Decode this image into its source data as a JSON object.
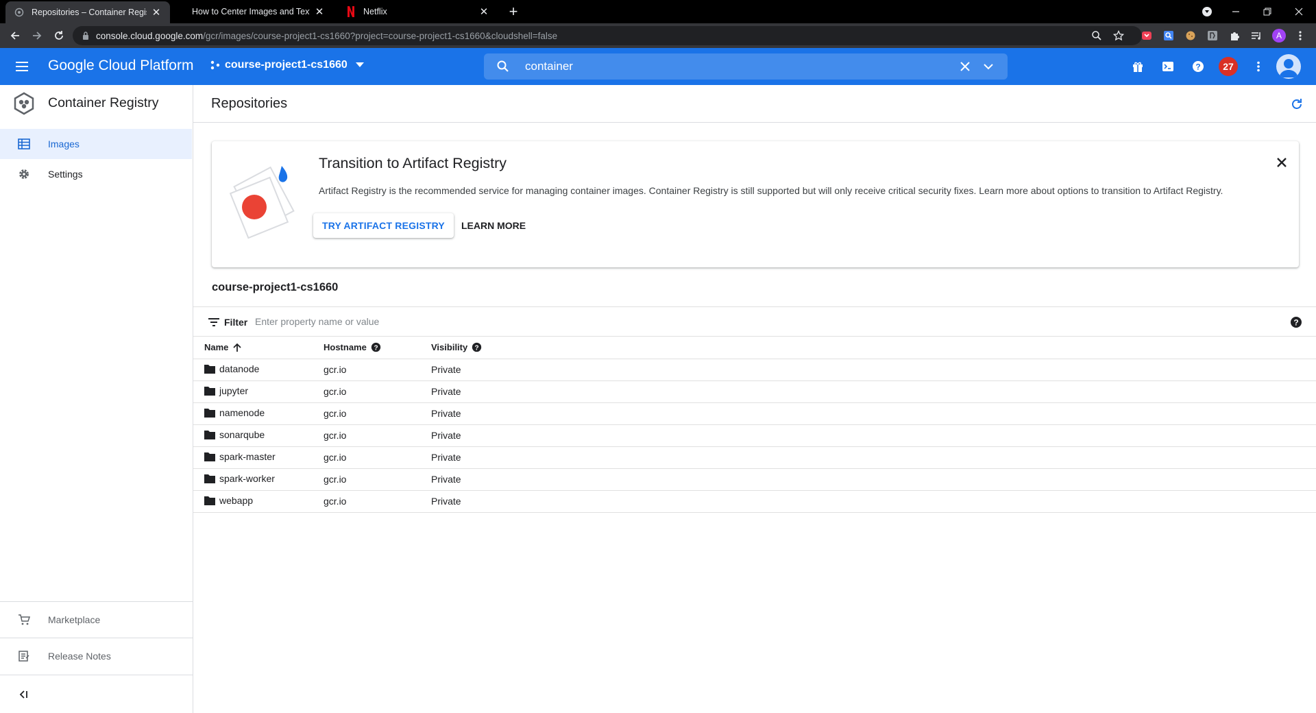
{
  "browser": {
    "tabs": [
      {
        "title": "Repositories – Container Registry",
        "active": true,
        "icon": "gcp-favicon"
      },
      {
        "title": "How to Center Images and Text i",
        "active": false,
        "icon": "none"
      },
      {
        "title": "Netflix",
        "active": false,
        "icon": "netflix-icon"
      }
    ],
    "url_host": "console.cloud.google.com",
    "url_path": "/gcr/images/course-project1-cs1660?project=course-project1-cs1660&cloudshell=false",
    "profile_initial": "A"
  },
  "header": {
    "brand": "Google Cloud Platform",
    "project": "course-project1-cs1660",
    "search_value": "container",
    "notifications_count": "27",
    "accent_color": "#1a73e8"
  },
  "sidebar": {
    "product_name": "Container Registry",
    "items": [
      {
        "label": "Images",
        "icon": "list-icon",
        "active": true
      },
      {
        "label": "Settings",
        "icon": "gear-icon",
        "active": false
      }
    ],
    "bottom": [
      {
        "label": "Marketplace",
        "icon": "cart-icon"
      },
      {
        "label": "Release Notes",
        "icon": "notes-icon"
      }
    ]
  },
  "main": {
    "page_title": "Repositories",
    "banner": {
      "title": "Transition to Artifact Registry",
      "description": "Artifact Registry is the recommended service for managing container images. Container Registry is still supported but will only receive critical security fixes. Learn more about options to transition to Artifact Registry.",
      "primary_button": "TRY ARTIFACT REGISTRY",
      "secondary_button": "LEARN MORE"
    },
    "section_title": "course-project1-cs1660",
    "filter": {
      "label": "Filter",
      "placeholder": "Enter property name or value"
    },
    "table": {
      "columns": [
        "Name",
        "Hostname",
        "Visibility"
      ],
      "rows": [
        {
          "name": "datanode",
          "hostname": "gcr.io",
          "visibility": "Private"
        },
        {
          "name": "jupyter",
          "hostname": "gcr.io",
          "visibility": "Private"
        },
        {
          "name": "namenode",
          "hostname": "gcr.io",
          "visibility": "Private"
        },
        {
          "name": "sonarqube",
          "hostname": "gcr.io",
          "visibility": "Private"
        },
        {
          "name": "spark-master",
          "hostname": "gcr.io",
          "visibility": "Private"
        },
        {
          "name": "spark-worker",
          "hostname": "gcr.io",
          "visibility": "Private"
        },
        {
          "name": "webapp",
          "hostname": "gcr.io",
          "visibility": "Private"
        }
      ]
    }
  }
}
